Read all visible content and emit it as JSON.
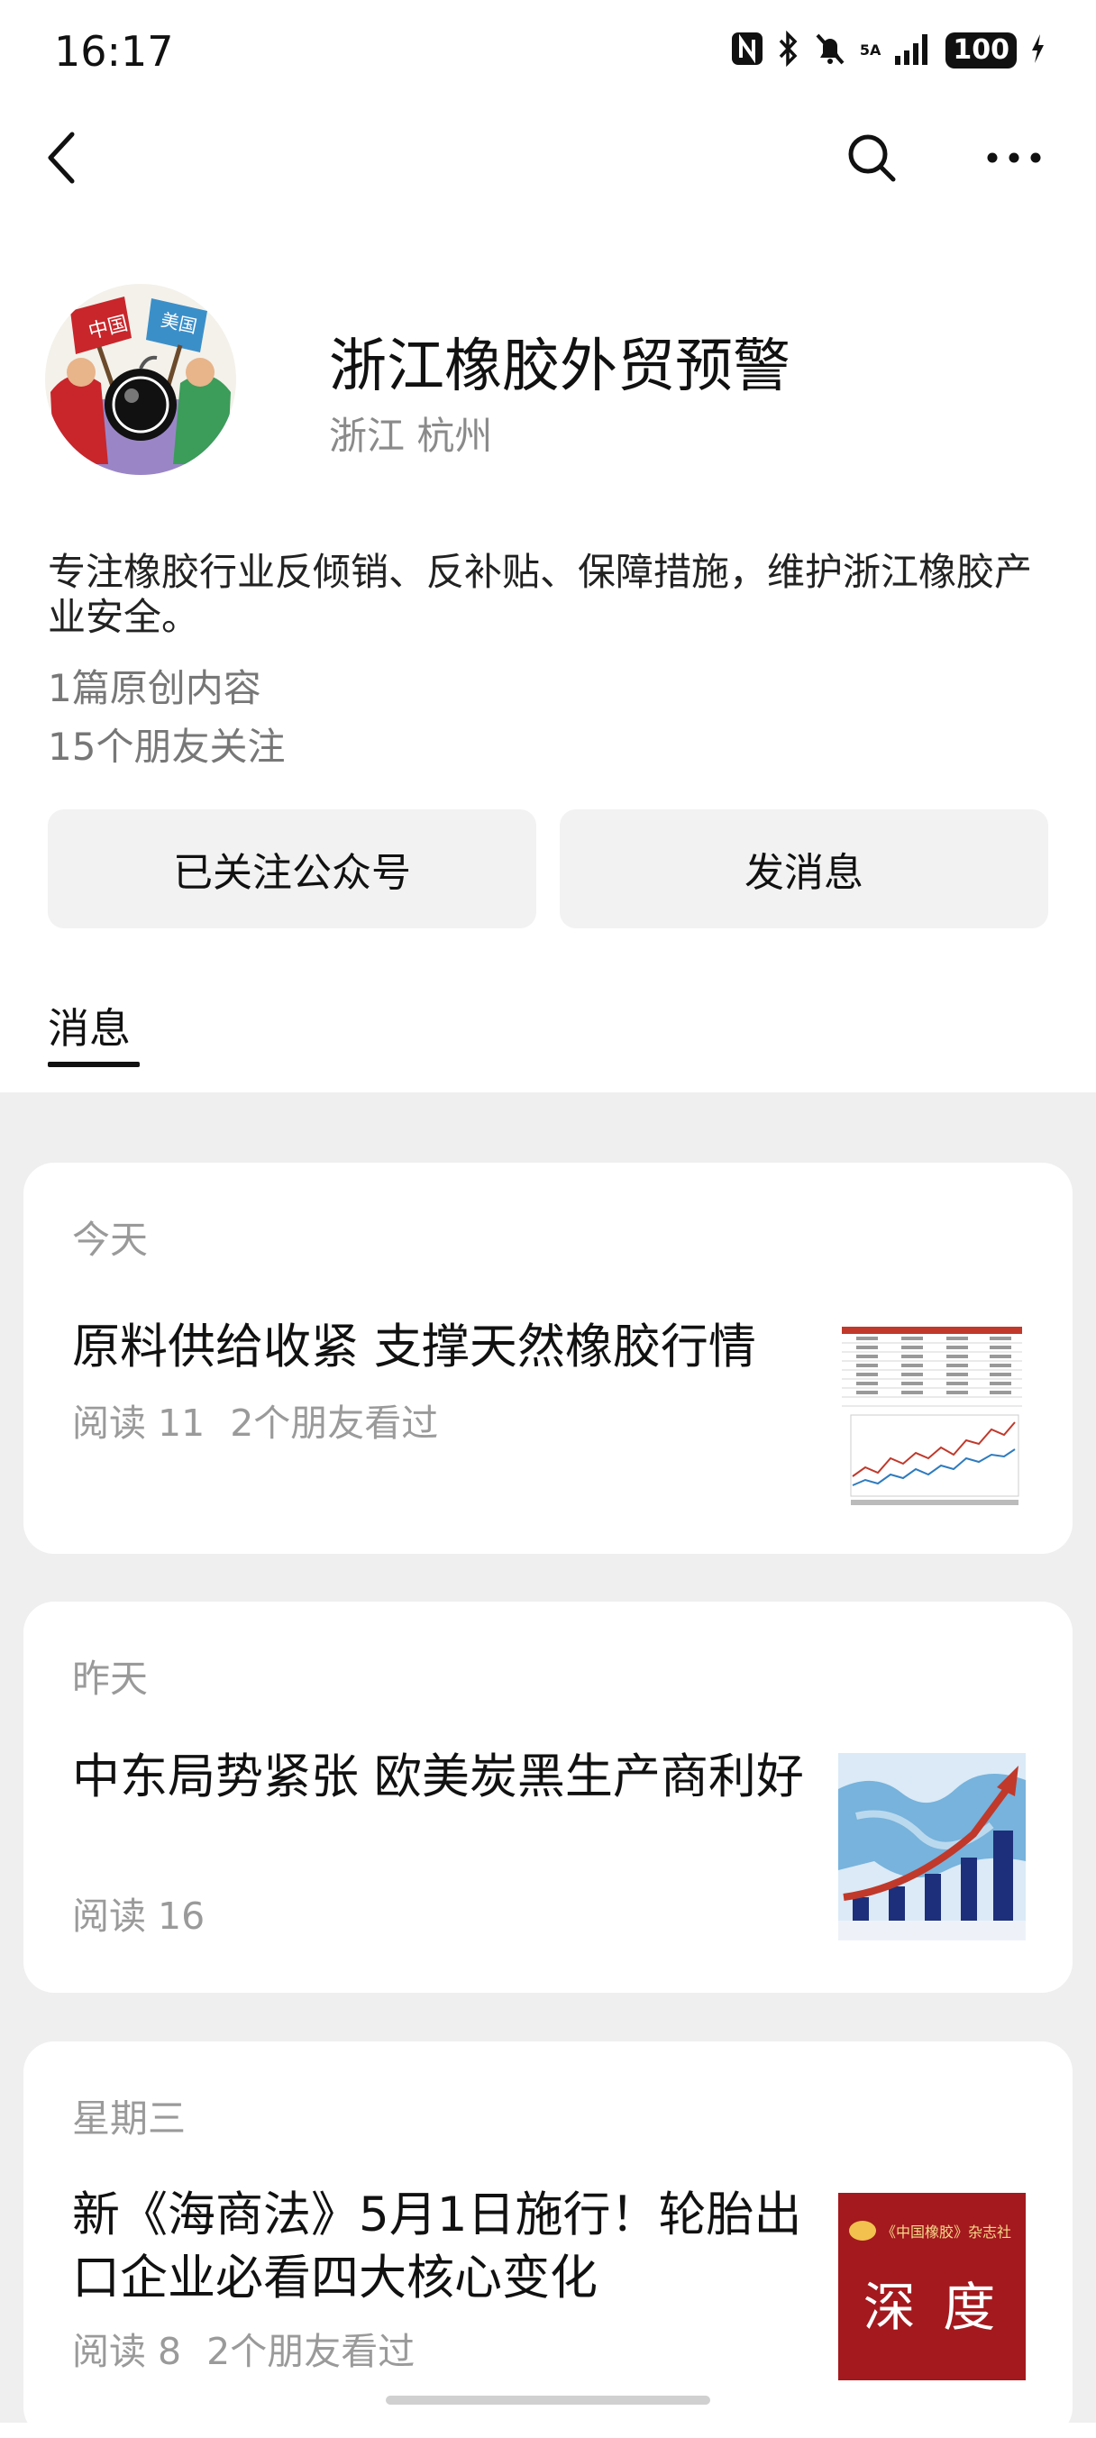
{
  "status_bar": {
    "time": "16:17",
    "network": "5A",
    "battery": "100"
  },
  "account": {
    "name": "浙江橡胶外贸预警",
    "location": "浙江 杭州",
    "description": "专注橡胶行业反倾销、反补贴、保障措施，维护浙江橡胶产业安全。",
    "original_count": "1篇原创内容",
    "friends_following": "15个朋友关注",
    "avatar_flag_left": "中国",
    "avatar_flag_right": "美国"
  },
  "actions": {
    "follow_label": "已关注公众号",
    "message_label": "发消息"
  },
  "tabs": {
    "messages": "消息"
  },
  "posts": [
    {
      "day": "今天",
      "title": "原料供给收紧 支撑天然橡胶行情",
      "reads": "阅读 11",
      "friends": "2个朋友看过",
      "thumb_icon": "chart-table-thumbnail"
    },
    {
      "day": "昨天",
      "title": "中东局势紧张 欧美炭黑生产商利好",
      "reads": "阅读 16",
      "friends": "",
      "thumb_icon": "growth-bar-chart-thumbnail"
    },
    {
      "day": "星期三",
      "title": "新《海商法》5月1日施行！轮胎出口企业必看四大核心变化",
      "reads": "阅读 8",
      "friends": "2个朋友看过",
      "thumb_icon": "depth-banner-thumbnail",
      "thumb_text": "深 度",
      "thumb_caption": "《中国橡胶》杂志社"
    }
  ],
  "colors": {
    "background": "#ffffff",
    "feed_background": "#efefef",
    "secondary_text": "#9a9a9a",
    "button_background": "#f2f2f2",
    "thumb_red": "#a3191d"
  }
}
